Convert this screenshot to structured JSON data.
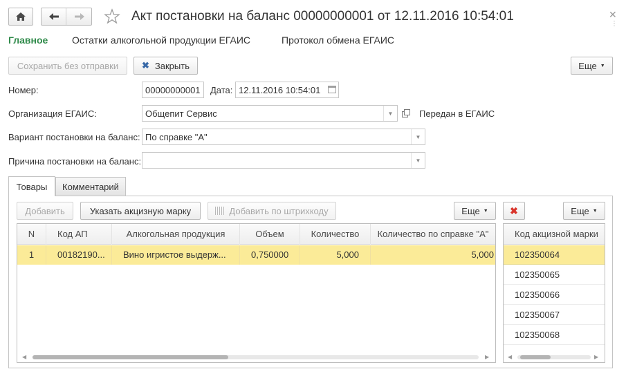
{
  "window": {
    "title": "Акт постановки на баланс 00000000001 от 12.11.2016 10:54:01"
  },
  "nav_tabs": [
    {
      "label": "Главное",
      "active": true
    },
    {
      "label": "Остатки алкогольной продукции ЕГАИС"
    },
    {
      "label": "Протокол обмена ЕГАИС"
    }
  ],
  "toolbar": {
    "save_label": "Сохранить без отправки",
    "close_label": "Закрыть",
    "more_label": "Еще"
  },
  "form": {
    "number_label": "Номер:",
    "number_value": "00000000001",
    "date_label": "Дата:",
    "date_value": "12.11.2016 10:54:01",
    "org_label": "Организация ЕГАИС:",
    "org_value": "Общепит Сервис",
    "org_status": "Передан в ЕГАИС",
    "variant_label": "Вариант постановки на баланс:",
    "variant_value": "По справке \"А\"",
    "reason_label": "Причина постановки на баланс:",
    "reason_value": ""
  },
  "content_tabs": [
    {
      "label": "Товары",
      "active": true
    },
    {
      "label": "Комментарий"
    }
  ],
  "goods_toolbar": {
    "add_label": "Добавить",
    "stamp_label": "Указать акцизную марку",
    "barcode_label": "Добавить по штрихкоду",
    "more_label": "Еще"
  },
  "goods_table": {
    "columns": [
      "N",
      "Код АП",
      "Алкогольная продукция",
      "Объем",
      "Количество",
      "Количество по справке \"А\""
    ],
    "rows": [
      [
        "1",
        "00182190...",
        "Вино игристое выдерж...",
        "0,750000",
        "5,000",
        "5,000"
      ]
    ]
  },
  "stamps_toolbar": {
    "more_label": "Еще"
  },
  "stamps_table": {
    "column": "Код акцизной марки",
    "rows": [
      "102350064",
      "102350065",
      "102350066",
      "102350067",
      "102350068"
    ]
  },
  "colors": {
    "accent_green": "#2f8a4a",
    "selected_row": "#fbeb98",
    "delete_red": "#d9342b"
  }
}
